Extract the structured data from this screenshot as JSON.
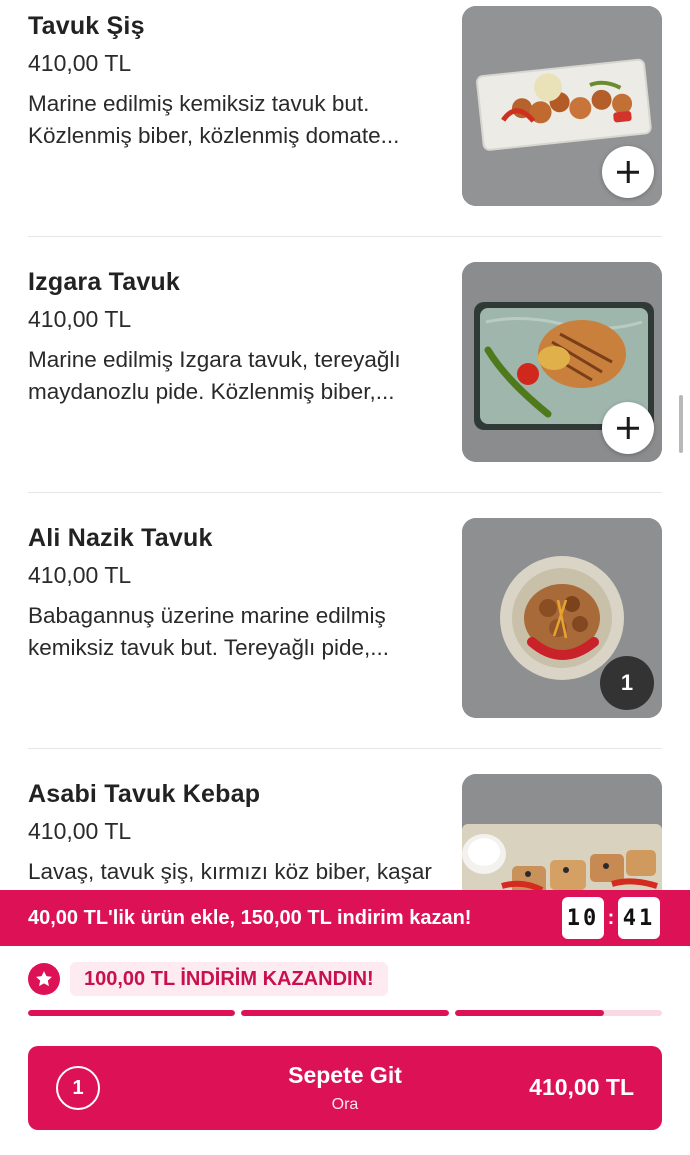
{
  "menu": {
    "items": [
      {
        "name": "Tavuk Şiş",
        "price": "410,00 TL",
        "description": "Marine edilmiş kemiksiz tavuk but. Közlenmiş biber, közlenmiş domate...",
        "image_icon": "food-photo-chicken-skewers",
        "action": "add"
      },
      {
        "name": "Izgara Tavuk",
        "price": "410,00 TL",
        "description": "Marine edilmiş Izgara tavuk, tereyağlı maydanozlu pide. Közlenmiş biber,...",
        "image_icon": "food-photo-grilled-chicken",
        "action": "add"
      },
      {
        "name": "Ali Nazik Tavuk",
        "price": "410,00 TL",
        "description": "Babagannuş üzerine marine edilmiş kemiksiz tavuk but. Tereyağlı pide,...",
        "image_icon": "food-photo-ali-nazik",
        "action": "quantity",
        "quantity": "1"
      },
      {
        "name": "Asabi Tavuk Kebap",
        "price": "410,00 TL",
        "description": "Lavaş, tavuk şiş, kırmızı köz biber, kaşar peyniri, susam ve çörek otu",
        "image_icon": "food-photo-kebab",
        "action": "add"
      }
    ]
  },
  "promo": {
    "text": "40,00 TL'lik ürün ekle, 150,00 TL indirim kazan!",
    "timer_minutes": "10",
    "timer_seconds": "41"
  },
  "discount": {
    "label": "100,00 TL İNDİRİM KAZANDIN!",
    "icon": "star-badge-icon"
  },
  "progress": {
    "segments_total": 3,
    "segments_complete": 2.72
  },
  "cart": {
    "count": "1",
    "label": "Sepete Git",
    "restaurant": "Ora",
    "total": "410,00 TL"
  },
  "colors": {
    "accent": "#dd1155",
    "accent_light": "#fdebf1",
    "qty_badge": "#333333"
  }
}
